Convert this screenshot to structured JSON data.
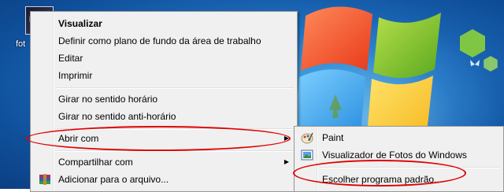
{
  "desktop": {
    "icon_label": "fot",
    "thumb_text": "Lu"
  },
  "context_menu": {
    "items": [
      {
        "label": "Visualizar",
        "bold": true
      },
      {
        "label": "Definir como plano de fundo da área de trabalho"
      },
      {
        "label": "Editar"
      },
      {
        "label": "Imprimir"
      },
      {
        "label": "Girar no sentido horário"
      },
      {
        "label": "Girar no sentido anti-horário"
      },
      {
        "label": "Abrir com",
        "submenu": true
      },
      {
        "label": "Compartilhar com",
        "submenu": true
      },
      {
        "label": "Adicionar para o arquivo...",
        "icon": "winrar-icon"
      }
    ]
  },
  "submenu": {
    "items": [
      {
        "label": "Paint",
        "icon": "paint-icon"
      },
      {
        "label": "Visualizador de Fotos do Windows",
        "icon": "photo-viewer-icon"
      },
      {
        "label": "Escolher programa padrão..."
      }
    ]
  },
  "colors": {
    "annotation": "#e00000",
    "menu_bg": "#f0f0f0",
    "desktop_blue": "#1f6fbf"
  }
}
